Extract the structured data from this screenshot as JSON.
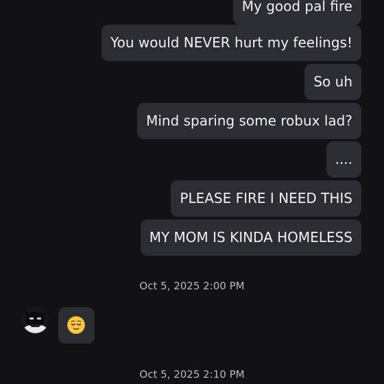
{
  "outgoing_messages": [
    "My good pal fire",
    "You would  NEVER hurt my feelings!",
    "So uh",
    "Mind sparing some robux lad?",
    "....",
    "PLEASE FIRE I NEED THIS",
    "MY MOM IS KINDA HOMELESS"
  ],
  "timestamps": [
    "Oct 5, 2025 2:00 PM",
    "Oct 5, 2025 2:10 PM"
  ],
  "incoming_message": {
    "content_icon": "relieved-face-emoji",
    "sender_avatar_icon": "avatar-icon"
  },
  "colors": {
    "background": "#111116",
    "bubble": "#2c2c33",
    "text": "#f1f1f3",
    "timestamp": "#b9b9c0",
    "emoji": "#f7c948"
  }
}
